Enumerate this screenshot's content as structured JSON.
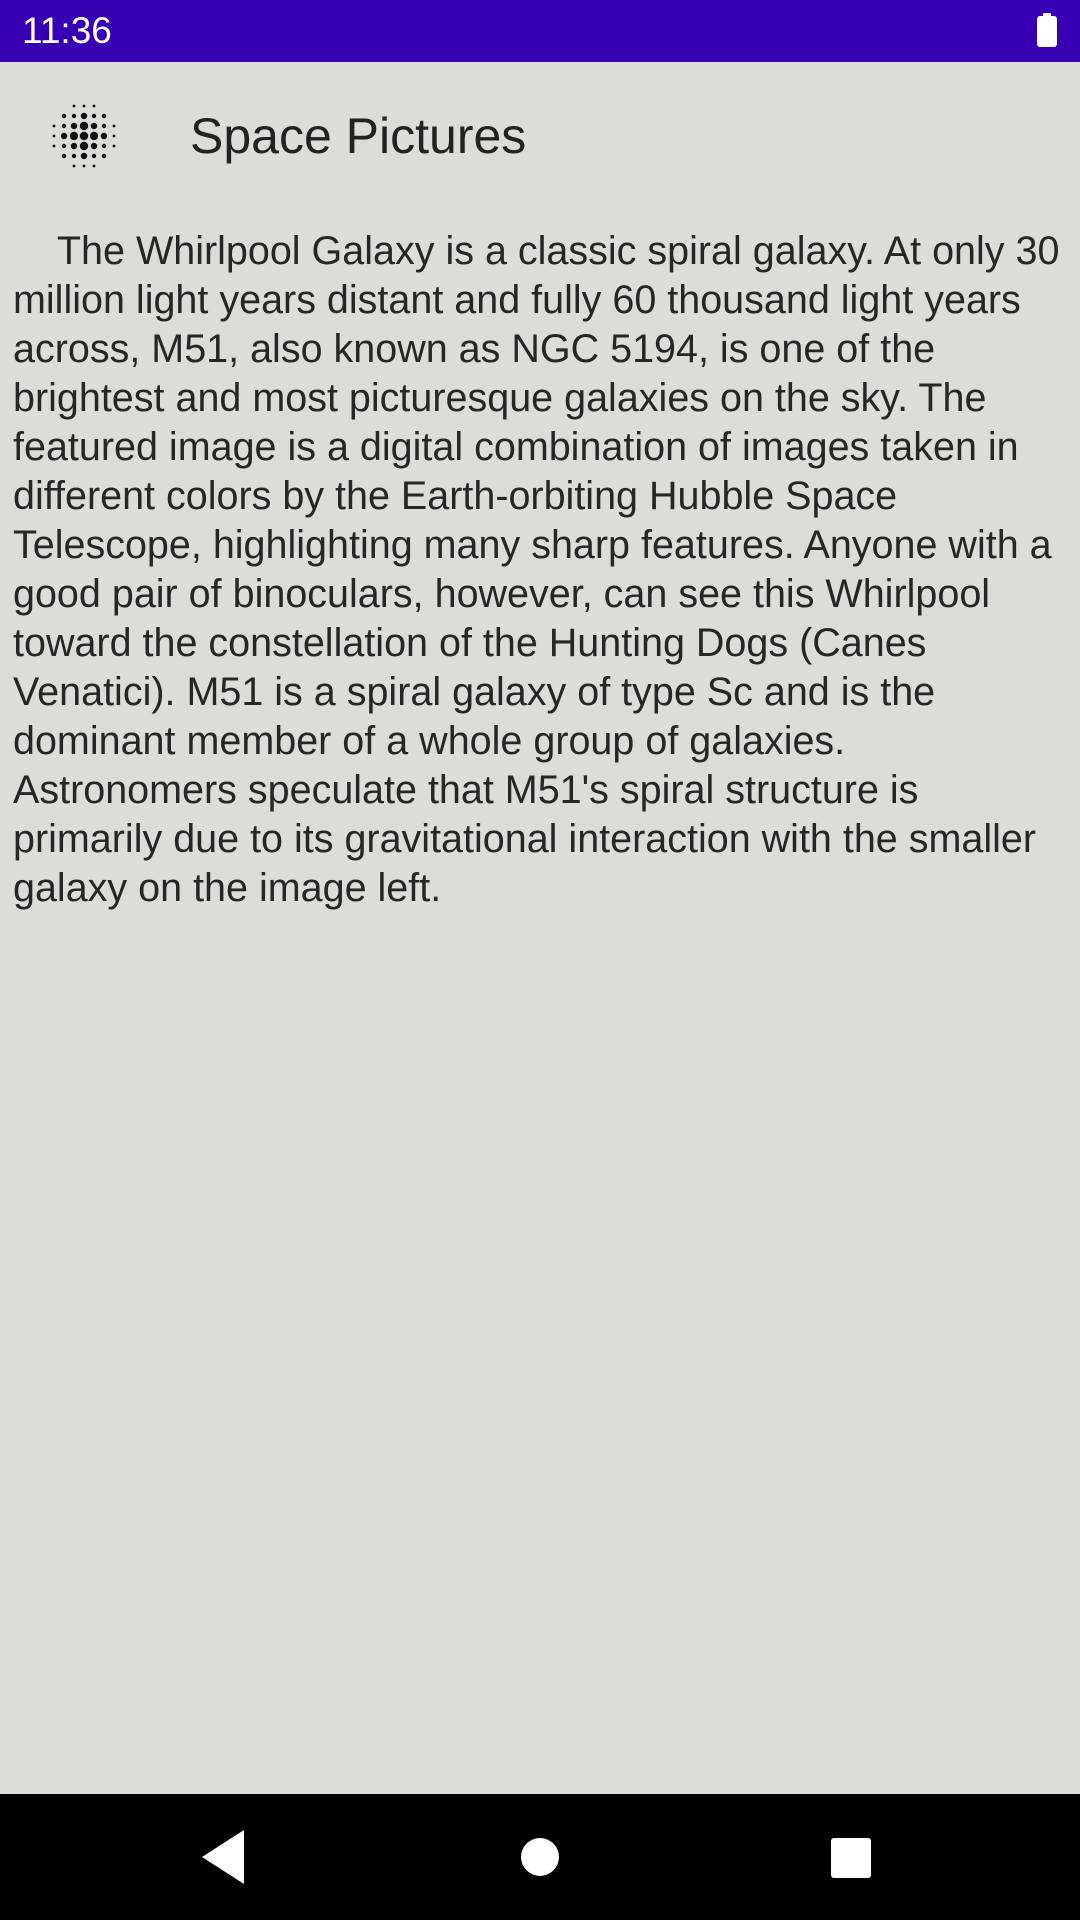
{
  "status_bar": {
    "time": "11:36",
    "battery_icon": "battery-full-icon",
    "background": "#3700b3"
  },
  "app_bar": {
    "icon": "galaxy-dots-icon",
    "title": "Space Pictures"
  },
  "content": {
    "description": "    The Whirlpool Galaxy is a classic spiral galaxy. At only 30 million light years distant and fully 60 thousand light years across, M51, also known as NGC 5194, is one of the brightest and most picturesque galaxies on the sky. The featured image is a digital combination of images taken in different colors by the Earth-orbiting Hubble Space Telescope, highlighting many sharp features. Anyone with a good pair of binoculars, however, can see this Whirlpool toward the constellation of the Hunting Dogs (Canes Venatici). M51 is a spiral galaxy of type Sc and is the dominant member of a whole group of galaxies.  Astronomers speculate that M51's spiral structure is primarily due to its gravitational interaction with the smaller galaxy on the image left."
  },
  "nav_bar": {
    "back_icon": "back-triangle-icon",
    "home_icon": "home-circle-icon",
    "recents_icon": "recents-square-icon"
  }
}
